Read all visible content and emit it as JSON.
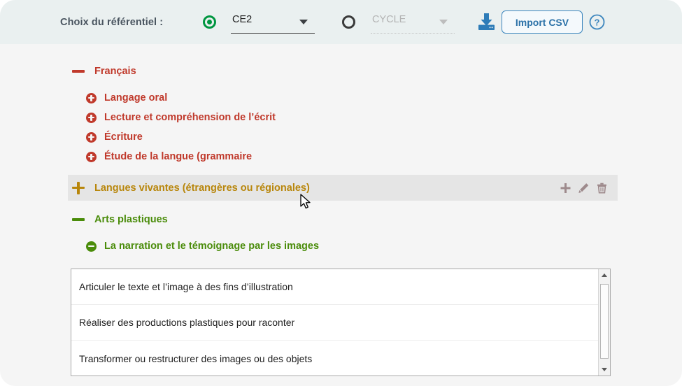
{
  "header": {
    "label": "Choix du référentiel :",
    "grade_select": {
      "value": "CE2",
      "enabled": true
    },
    "cycle_select": {
      "value": "CYCLE",
      "enabled": false
    },
    "download_icon": "download-icon",
    "import_button": "Import CSV",
    "help_icon": "help-circle-icon"
  },
  "colors": {
    "header_bg": "#eaf0f0",
    "body_bg": "#f5f5f5",
    "red": "#c0392b",
    "gold": "#b8860b",
    "green": "#4a8c0a",
    "blue": "#2c72a8",
    "radio_on": "#009640",
    "row_highlight": "#e5e5e5",
    "action_icon": "#9e8a8c"
  },
  "tree": [
    {
      "label": "Français",
      "color": "#c0392b",
      "toggle": "minus-dash",
      "level": 0,
      "highlighted": false,
      "children": [
        {
          "label": "Langage oral",
          "color": "#c0392b",
          "toggle": "plus-circle",
          "level": 1
        },
        {
          "label": "Lecture et compréhension de l’écrit",
          "color": "#c0392b",
          "toggle": "plus-circle",
          "level": 1
        },
        {
          "label": "Écriture",
          "color": "#c0392b",
          "toggle": "plus-circle",
          "level": 1
        },
        {
          "label": "Étude de la langue (grammaire",
          "color": "#c0392b",
          "toggle": "plus-circle",
          "level": 1
        }
      ]
    },
    {
      "label": "Langues vivantes (étrangères ou régionales)",
      "color": "#b8860b",
      "toggle": "plus-thin",
      "level": 0,
      "highlighted": true,
      "actions": [
        "add-icon",
        "edit-icon",
        "delete-icon"
      ],
      "children": []
    },
    {
      "label": "Arts plastiques",
      "color": "#4a8c0a",
      "toggle": "minus-dash",
      "level": 0,
      "highlighted": false,
      "children": [
        {
          "label": "La narration et le témoignage par les images",
          "color": "#4a8c0a",
          "toggle": "minus-circle",
          "level": 1
        }
      ]
    }
  ],
  "competency_list": {
    "items": [
      "Articuler le texte et l’image à des fins d’illustration",
      "Réaliser des productions plastiques pour raconter",
      "Transformer ou restructurer des images ou des objets"
    ],
    "scrollbar": {
      "up_arrow": "chevron-up-icon",
      "down_arrow": "chevron-down-icon"
    }
  }
}
